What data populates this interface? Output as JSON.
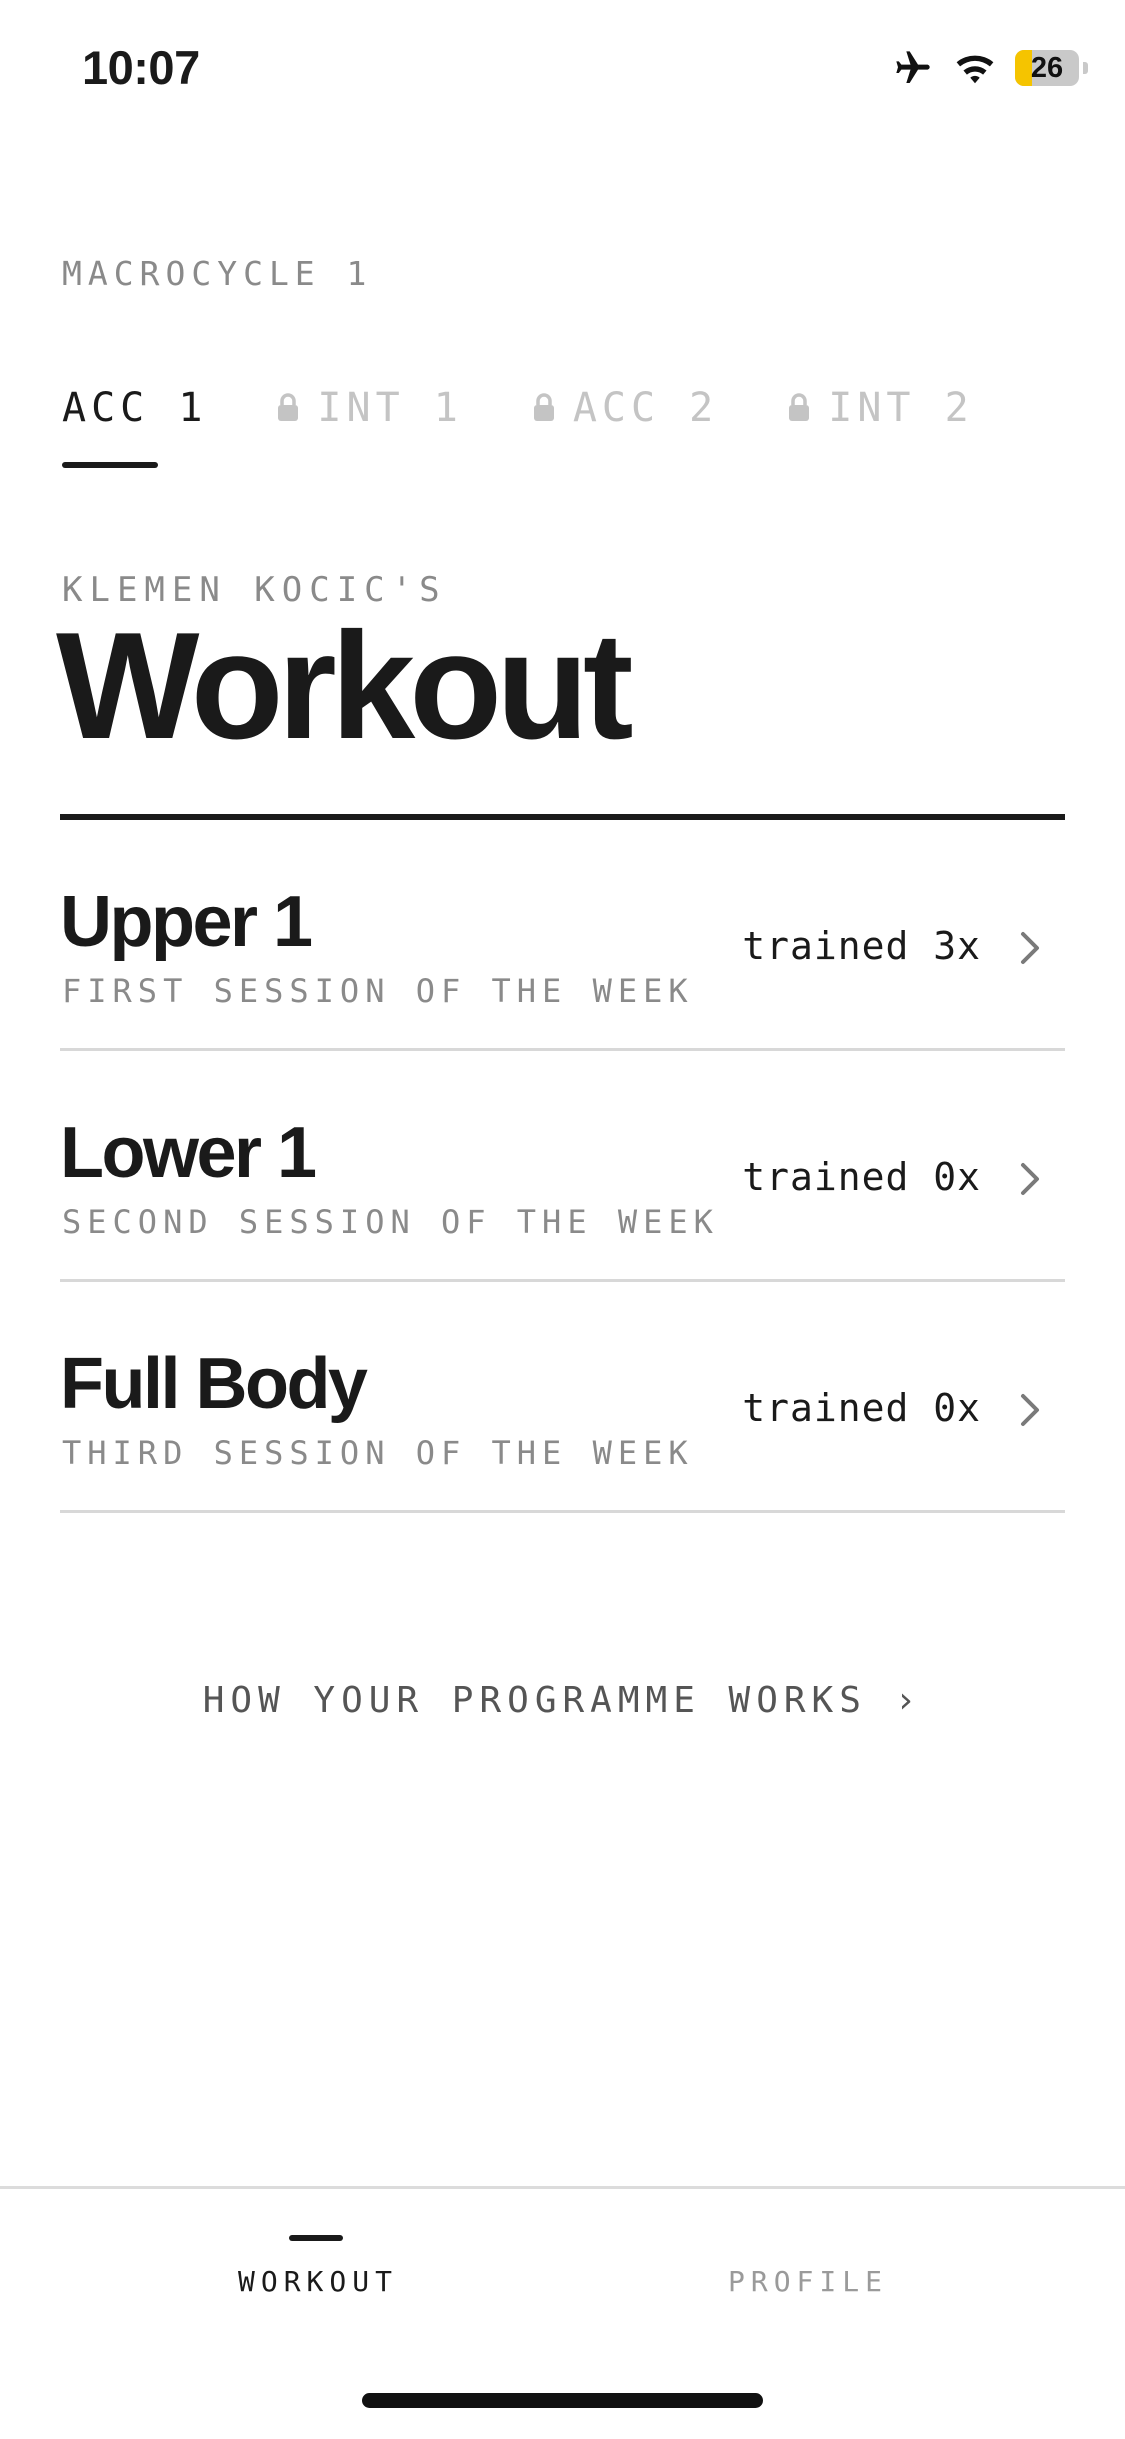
{
  "status_bar": {
    "time": "10:07",
    "battery_level": "26",
    "battery_fraction": 0.26,
    "icons": [
      "airplane-icon",
      "wifi-icon",
      "battery-icon"
    ]
  },
  "macrocycle_label": "MACROCYCLE 1",
  "phase_tabs": [
    {
      "label": "ACC 1",
      "locked": false,
      "active": true
    },
    {
      "label": "INT 1",
      "locked": true,
      "active": false
    },
    {
      "label": "ACC 2",
      "locked": true,
      "active": false
    },
    {
      "label": "INT 2",
      "locked": true,
      "active": false
    }
  ],
  "owner_label": "KLEMEN KOCIC'S",
  "page_title": "Workout",
  "sessions": [
    {
      "name": "Upper 1",
      "subtitle": "FIRST SESSION OF THE WEEK",
      "count": "trained 3x"
    },
    {
      "name": "Lower 1",
      "subtitle": "SECOND SESSION OF THE WEEK",
      "count": "trained 0x"
    },
    {
      "name": "Full Body",
      "subtitle": "THIRD SESSION OF THE WEEK",
      "count": "trained 0x"
    }
  ],
  "programme_link": "HOW YOUR PROGRAMME WORKS ›",
  "bottom_nav": [
    {
      "label": "WORKOUT",
      "active": true
    },
    {
      "label": "PROFILE",
      "active": false
    }
  ],
  "colors": {
    "text": "#1a1a1a",
    "muted": "#8a8a8a",
    "locked": "#c4c4c4",
    "battery": "#f5c400",
    "divider": "#d8d8d8"
  }
}
